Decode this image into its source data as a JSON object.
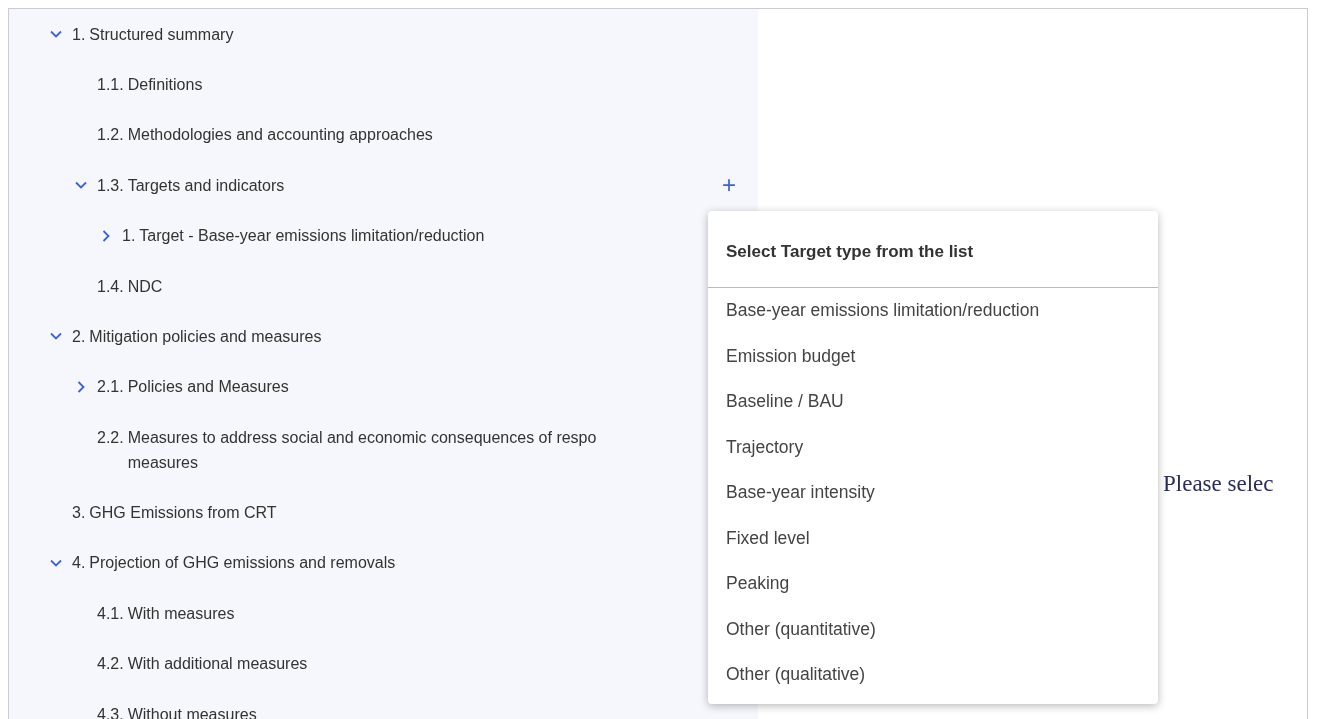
{
  "tree": [
    {
      "number": "1.",
      "label": "Structured summary",
      "expanded": true,
      "children": [
        {
          "number": "1.1.",
          "label": "Definitions"
        },
        {
          "number": "1.2.",
          "label": "Methodologies and accounting approaches"
        },
        {
          "number": "1.3.",
          "label": "Targets and indicators",
          "expanded": true,
          "add_button": "+",
          "children": [
            {
              "number": "1.",
              "label": "Target - Base-year emissions limitation/reduction",
              "expanded": false
            }
          ]
        },
        {
          "number": "1.4.",
          "label": "NDC"
        }
      ]
    },
    {
      "number": "2.",
      "label": "Mitigation policies and measures",
      "expanded": true,
      "children": [
        {
          "number": "2.1.",
          "label": "Policies and Measures",
          "expanded": false
        },
        {
          "number": "2.2.",
          "label": "Measures to address social and economic consequences of respo",
          "label_continued": "measures"
        }
      ]
    },
    {
      "number": "3.",
      "label": "GHG Emissions from CRT"
    },
    {
      "number": "4.",
      "label": "Projection of GHG emissions and removals",
      "expanded": true,
      "children": [
        {
          "number": "4.1.",
          "label": "With measures"
        },
        {
          "number": "4.2.",
          "label": "With additional measures"
        },
        {
          "number": "4.3.",
          "label": "Without measures"
        }
      ]
    }
  ],
  "menu": {
    "title": "Select Target type from the list",
    "options": [
      {
        "label": "Base-year emissions limitation/reduction",
        "selected": false
      },
      {
        "label": "Emission budget",
        "selected": false
      },
      {
        "label": "Baseline / BAU",
        "selected": false
      },
      {
        "label": "Trajectory",
        "selected": false
      },
      {
        "label": "Base-year intensity",
        "selected": false
      },
      {
        "label": "Fixed level",
        "selected": false
      },
      {
        "label": "Peaking",
        "selected": false
      },
      {
        "label": "Other (quantitative)",
        "selected": false
      },
      {
        "label": "Other (qualitative)",
        "selected": false
      }
    ]
  },
  "content": {
    "message": "Please selec"
  }
}
